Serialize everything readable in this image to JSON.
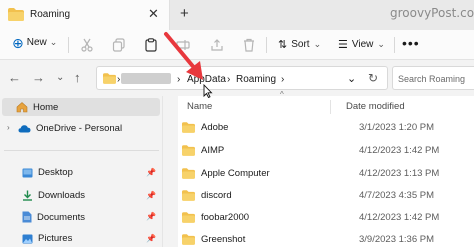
{
  "window": {
    "tab_title": "Roaming",
    "tab_close": "✕",
    "new_tab": "+",
    "watermark": "groovyPost.com"
  },
  "toolbar": {
    "new_label": "New",
    "new_chevron": "⌄",
    "sort_label": "Sort",
    "view_label": "View",
    "more_label": "•••"
  },
  "address": {
    "crumbs": [
      "AppData",
      "Roaming"
    ],
    "separator": "›",
    "search_placeholder": "Search Roaming"
  },
  "sidebar": {
    "items": [
      {
        "label": "Home",
        "icon": "home-icon"
      },
      {
        "label": "OneDrive - Personal",
        "icon": "cloud-icon"
      },
      {
        "label": "Desktop",
        "icon": "desktop-icon",
        "pinned": true
      },
      {
        "label": "Downloads",
        "icon": "download-icon",
        "pinned": true
      },
      {
        "label": "Documents",
        "icon": "documents-icon",
        "pinned": true
      },
      {
        "label": "Pictures",
        "icon": "pictures-icon",
        "pinned": true
      }
    ]
  },
  "file_list": {
    "columns": [
      "Name",
      "Date modified"
    ],
    "rows": [
      {
        "name": "Adobe",
        "date": "3/1/2023 1:20 PM"
      },
      {
        "name": "AIMP",
        "date": "4/12/2023 1:42 PM"
      },
      {
        "name": "Apple Computer",
        "date": "4/12/2023 1:13 PM"
      },
      {
        "name": "discord",
        "date": "4/7/2023 4:35 PM"
      },
      {
        "name": "foobar2000",
        "date": "4/12/2023 1:42 PM"
      },
      {
        "name": "Greenshot",
        "date": "3/9/2023 1:36 PM"
      }
    ]
  },
  "colors": {
    "folder": "#f2c14e",
    "accent": "#0067c0",
    "annotation_arrow": "#e8383d"
  }
}
